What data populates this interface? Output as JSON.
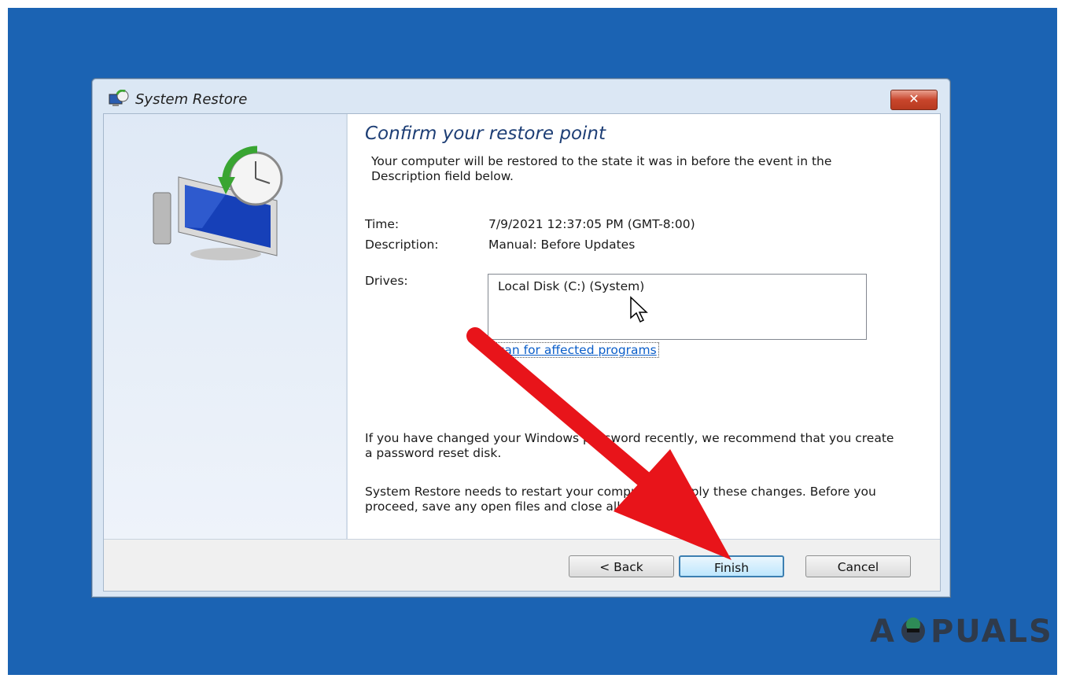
{
  "window": {
    "title": "System Restore",
    "close_label": "✕"
  },
  "content": {
    "heading": "Confirm your restore point",
    "intro": "Your computer will be restored to the state it was in before the event in the Description field below.",
    "time_label": "Time:",
    "time_value": "7/9/2021 12:37:05 PM (GMT-8:00)",
    "description_label": "Description:",
    "description_value": "Manual: Before Updates",
    "drives_label": "Drives:",
    "drives": [
      "Local Disk (C:) (System)"
    ],
    "scan_link": "Scan for affected programs",
    "password_note": "If you have changed your Windows password recently, we recommend that you create a password reset disk.",
    "restart_note": "System Restore needs to restart your computer to apply these changes. Before you proceed, save any open files and close all programs."
  },
  "buttons": {
    "back": "< Back",
    "finish": "Finish",
    "cancel": "Cancel"
  },
  "watermark": {
    "left": "A",
    "right": "PUALS"
  },
  "colors": {
    "desktop": "#1b63b3",
    "annotation_arrow": "#e8141a",
    "heading": "#1d3e75",
    "link": "#0b5ec9"
  }
}
